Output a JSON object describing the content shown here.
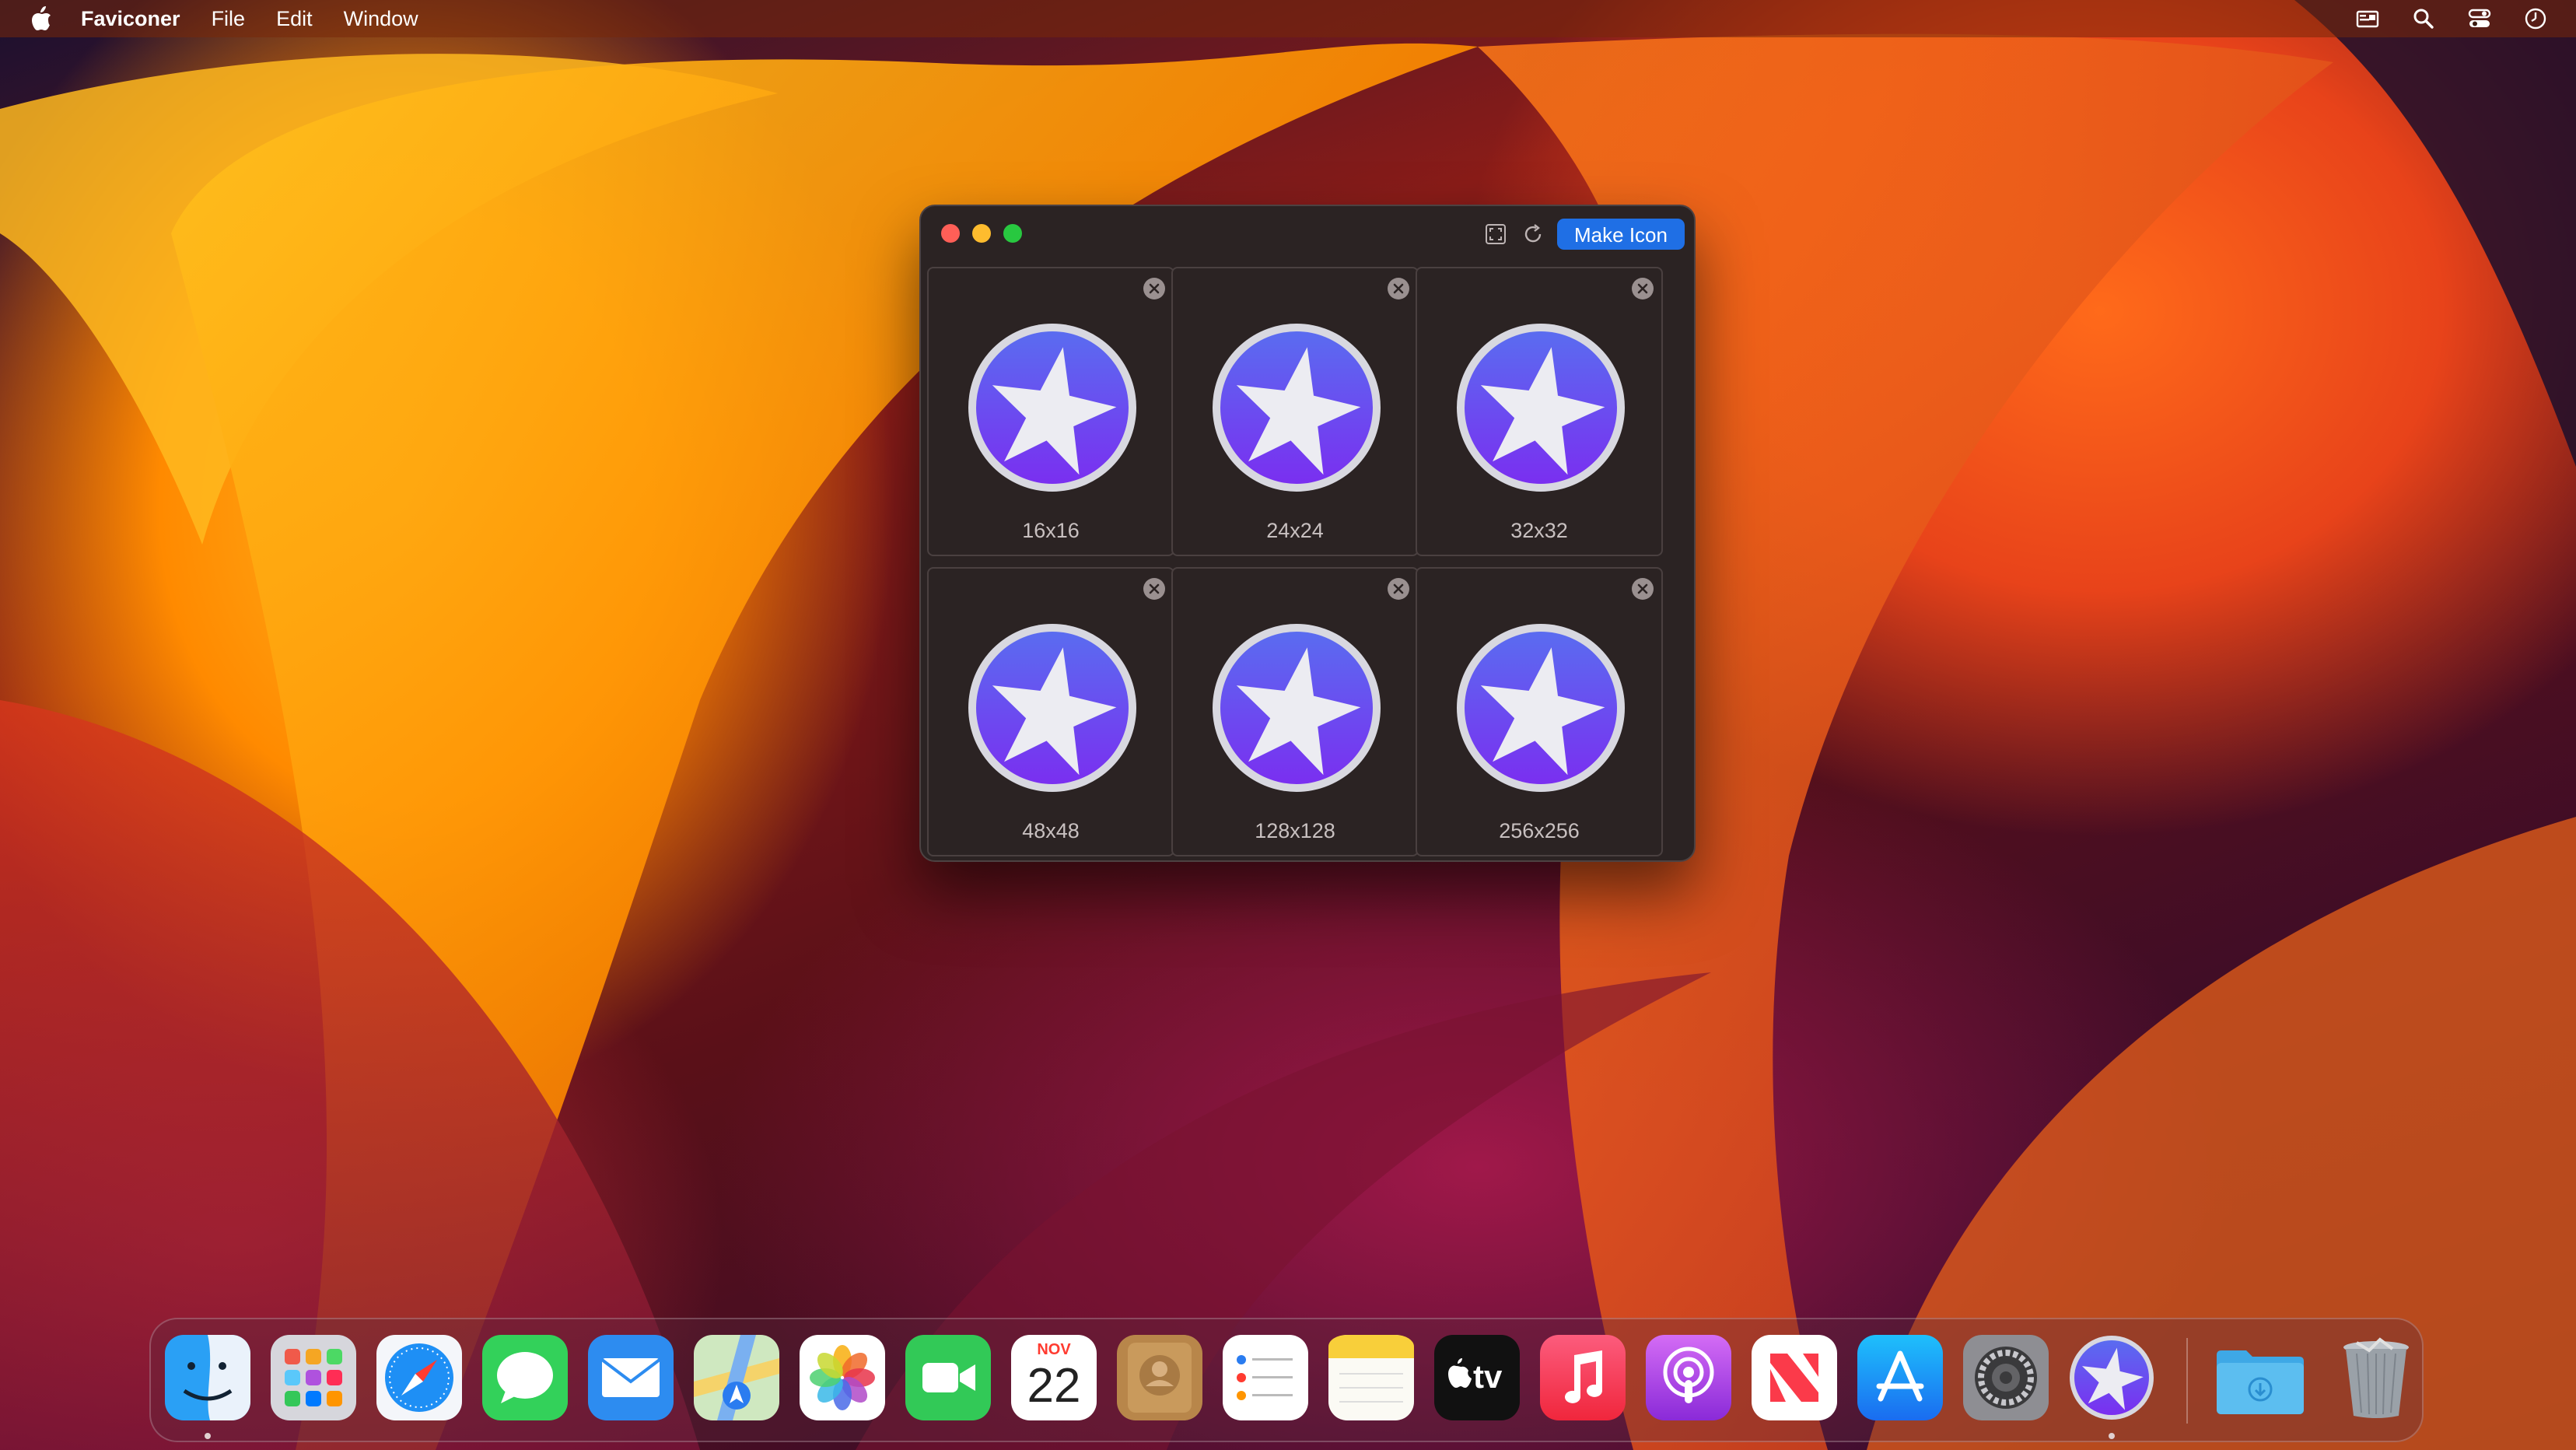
{
  "menubar": {
    "app_name": "Faviconer",
    "menus": [
      "File",
      "Edit",
      "Window"
    ],
    "status_icons": [
      "wallet-icon",
      "search-icon",
      "control-center-icon",
      "clock-icon"
    ]
  },
  "window": {
    "toolbar": {
      "make_icon_label": "Make Icon",
      "icons": [
        "fullscreen-icon",
        "refresh-icon"
      ]
    },
    "sizes": [
      "16x16",
      "24x24",
      "32x32",
      "48x48",
      "128x128",
      "256x256"
    ]
  },
  "dock": {
    "apps": [
      "Finder",
      "Launchpad",
      "Safari",
      "Messages",
      "Mail",
      "Maps",
      "Photos",
      "FaceTime",
      "Calendar",
      "Contacts",
      "Reminders",
      "Notes",
      "TV",
      "Music",
      "Podcasts",
      "News",
      "App Store",
      "System Settings",
      "Faviconer",
      "Downloads",
      "Trash"
    ],
    "calendar_month": "NOV",
    "calendar_day": "22",
    "tv_label": "tv"
  },
  "colors": {
    "accent": "#1f6fe5",
    "icon_purple": "#7a2ff0",
    "icon_blue": "#5a6cf0"
  }
}
